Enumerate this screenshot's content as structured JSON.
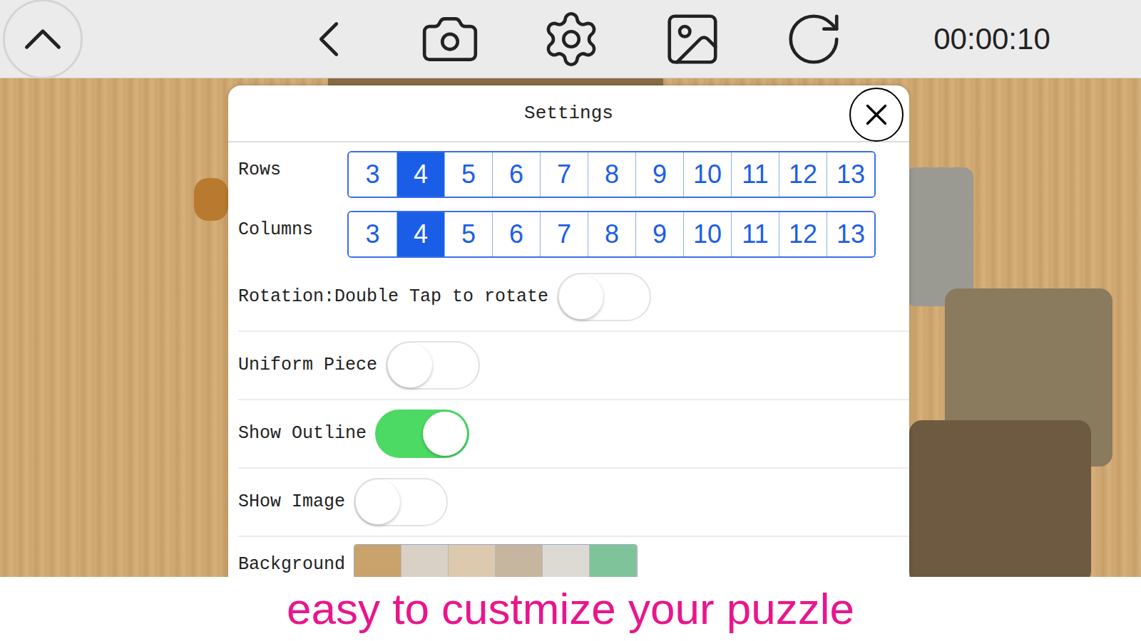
{
  "toolbar": {
    "timer": "00:00:10"
  },
  "settings": {
    "title": "Settings",
    "grids": [
      {
        "label": "Rows",
        "options": [
          {
            "label": "3",
            "selected": false
          },
          {
            "label": "4",
            "selected": true
          },
          {
            "label": "5",
            "selected": false
          },
          {
            "label": "6",
            "selected": false
          },
          {
            "label": "7",
            "selected": false
          },
          {
            "label": "8",
            "selected": false
          },
          {
            "label": "9",
            "selected": false
          },
          {
            "label": "10",
            "selected": false
          },
          {
            "label": "11",
            "selected": false
          },
          {
            "label": "12",
            "selected": false
          },
          {
            "label": "13",
            "selected": false
          }
        ]
      },
      {
        "label": "Columns",
        "options": [
          {
            "label": "3",
            "selected": false
          },
          {
            "label": "4",
            "selected": true
          },
          {
            "label": "5",
            "selected": false
          },
          {
            "label": "6",
            "selected": false
          },
          {
            "label": "7",
            "selected": false
          },
          {
            "label": "8",
            "selected": false
          },
          {
            "label": "9",
            "selected": false
          },
          {
            "label": "10",
            "selected": false
          },
          {
            "label": "11",
            "selected": false
          },
          {
            "label": "12",
            "selected": false
          },
          {
            "label": "13",
            "selected": false
          }
        ]
      }
    ],
    "toggles": [
      {
        "label": "Rotation:Double Tap to rotate",
        "on": false
      },
      {
        "label": "Uniform Piece",
        "on": false
      },
      {
        "label": "Show Outline",
        "on": true
      },
      {
        "label": "SHow Image",
        "on": false
      }
    ],
    "background": {
      "label": "Background",
      "swatches": [
        {
          "color": "#c9a26c"
        },
        {
          "color": "#d9d0c6"
        },
        {
          "color": "#dcc9ae"
        },
        {
          "color": "#c6b59f"
        },
        {
          "color": "#dddad3"
        },
        {
          "color": "#7fc39a"
        }
      ]
    }
  },
  "caption": "easy to custmize your puzzle"
}
